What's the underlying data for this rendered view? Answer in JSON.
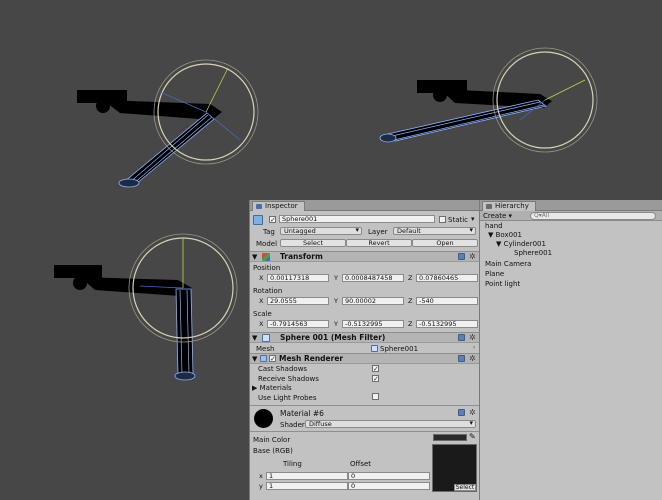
{
  "inspector": {
    "tab_label": "Inspector",
    "object_name": "Sphere001",
    "static_label": "Static",
    "tag_label": "Tag",
    "tag_value": "Untagged",
    "layer_label": "Layer",
    "layer_value": "Default",
    "model_label": "Model",
    "model_buttons": [
      "Select",
      "Revert",
      "Open"
    ],
    "transform": {
      "title": "Transform",
      "position_label": "Position",
      "rotation_label": "Rotation",
      "scale_label": "Scale",
      "axes": [
        "X",
        "Y",
        "Z"
      ],
      "position": [
        "0.00117318",
        "0.0008487458",
        "0.07860465"
      ],
      "rotation": [
        "29.0555",
        "90.00002",
        "-540"
      ],
      "scale": [
        "-0.7914563",
        "-0.5132995",
        "-0.5132995"
      ]
    },
    "mesh_filter": {
      "title": "Sphere 001 (Mesh Filter)",
      "mesh_label": "Mesh",
      "mesh_value": "Sphere001"
    },
    "mesh_renderer": {
      "title": "Mesh Renderer",
      "cast_shadows": "Cast Shadows",
      "receive_shadows": "Receive Shadows",
      "materials": "Materials",
      "use_light_probes": "Use Light Probes"
    },
    "material": {
      "name": "Material #6",
      "shader_label": "Shader",
      "shader_value": "Diffuse",
      "main_color": "Main Color",
      "base_rgb": "Base (RGB)",
      "tiling_label": "Tiling",
      "offset_label": "Offset",
      "x_label": "x",
      "y_label": "y",
      "tiling": [
        "1",
        "1"
      ],
      "offset": [
        "0",
        "0"
      ],
      "select_label": "Select"
    }
  },
  "hierarchy": {
    "tab_label": "Hierarchy",
    "create_label": "Create",
    "search_placeholder": "Q▾All",
    "items": [
      "hand",
      "Box001",
      "Cylinder001",
      "Sphere001",
      "Main Camera",
      "Plane",
      "Point light"
    ]
  },
  "colors": {
    "viewport_bg": "#474747",
    "panel_bg": "#c2c2c2",
    "wire_blue": "#8fb3ff",
    "gizmo_ring": "#d8d2b4",
    "gizmo_green": "#b8d94a",
    "gizmo_blue": "#4a6ab8"
  }
}
